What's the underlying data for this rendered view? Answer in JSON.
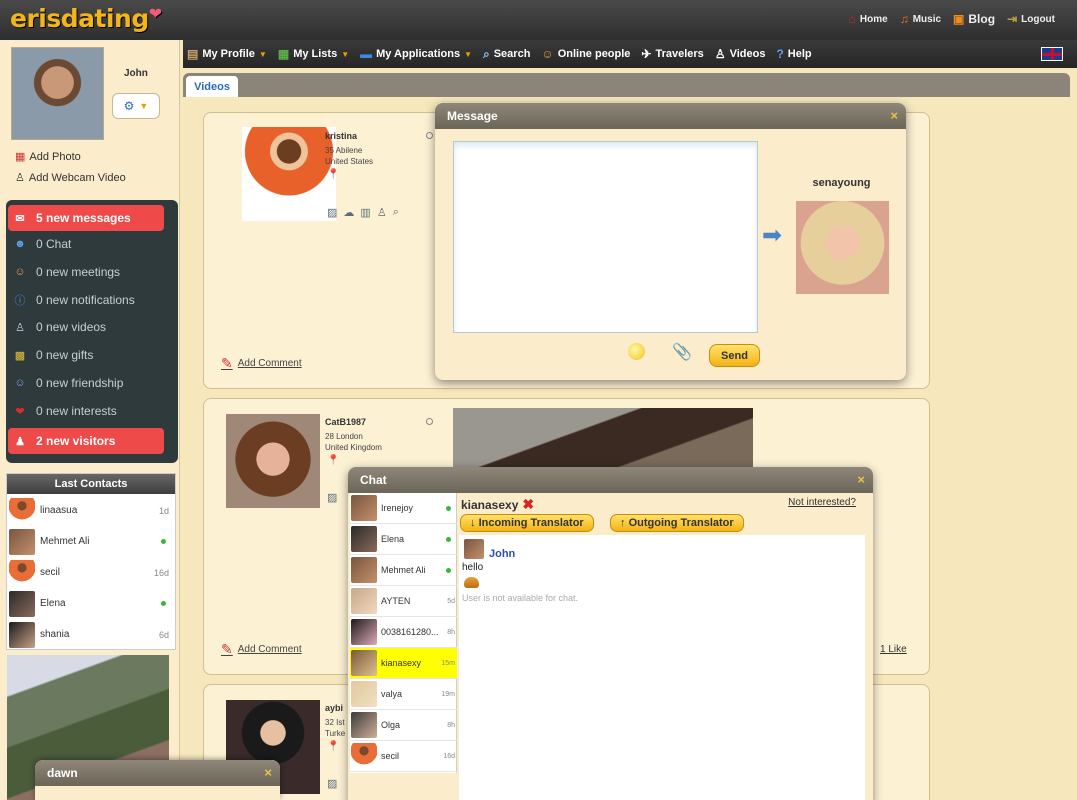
{
  "header": {
    "logo": "erisdating",
    "logo_heart": "❤",
    "links": [
      {
        "label": "Home",
        "icon": "house-icon"
      },
      {
        "label": "Music",
        "icon": "headphones-icon"
      },
      {
        "label": "Blog",
        "icon": "blog-icon"
      },
      {
        "label": "Logout",
        "icon": "logout-icon"
      }
    ]
  },
  "profile": {
    "name": "John",
    "add_photo": "Add Photo",
    "add_webcam_video": "Add Webcam Video"
  },
  "notifications": [
    {
      "label": "5 new messages",
      "active": true
    },
    {
      "label": "0 Chat",
      "active": false
    },
    {
      "label": "0 new meetings",
      "active": false
    },
    {
      "label": "0 new notifications",
      "active": false
    },
    {
      "label": "0 new videos",
      "active": false
    },
    {
      "label": "0 new gifts",
      "active": false
    },
    {
      "label": "0 new friendship",
      "active": false
    },
    {
      "label": "0 new interests",
      "active": false
    },
    {
      "label": "2 new visitors",
      "active": true
    }
  ],
  "last_contacts": {
    "title": "Last Contacts",
    "items": [
      {
        "name": "linaasua",
        "when": "1d",
        "online": false
      },
      {
        "name": "Mehmet Ali",
        "when": "",
        "online": true
      },
      {
        "name": "secil",
        "when": "16d",
        "online": false
      },
      {
        "name": "Elena",
        "when": "",
        "online": true
      },
      {
        "name": "shania",
        "when": "6d",
        "online": false
      }
    ]
  },
  "nav": {
    "items": [
      {
        "label": "My Profile",
        "icon": "profile-icon",
        "dropdown": true
      },
      {
        "label": "My Lists",
        "icon": "calendar-icon",
        "dropdown": true
      },
      {
        "label": "My Applications",
        "icon": "apps-icon",
        "dropdown": true
      },
      {
        "label": "Search",
        "icon": "search-icon",
        "dropdown": false
      },
      {
        "label": "Online people",
        "icon": "people-icon",
        "dropdown": false
      },
      {
        "label": "Travelers",
        "icon": "plane-icon",
        "dropdown": false
      },
      {
        "label": "Videos",
        "icon": "webcam-icon",
        "dropdown": false
      },
      {
        "label": "Help",
        "icon": "help-icon",
        "dropdown": false
      }
    ],
    "tab": "Videos"
  },
  "cards": [
    {
      "name": "kristina",
      "meta1": "35 Abilene",
      "meta2": "United States",
      "add_comment": "Add Comment"
    },
    {
      "name": "CatB1987",
      "meta1": "28 London",
      "meta2": "United Kingdom",
      "add_comment": "Add Comment",
      "likes": "1 Like"
    },
    {
      "name": "aybi",
      "meta1": "32 Ist",
      "meta2": "Turke"
    }
  ],
  "message_popup": {
    "title": "Message",
    "close": "×",
    "recipient": "senayoung",
    "send": "Send"
  },
  "chat_popup": {
    "title": "Chat",
    "close": "×",
    "contacts": [
      {
        "name": "Irenejoy",
        "when": "",
        "online": true
      },
      {
        "name": "Elena",
        "when": "",
        "online": true
      },
      {
        "name": "Mehmet Ali",
        "when": "",
        "online": true
      },
      {
        "name": "AYTEN",
        "when": "5d",
        "online": false
      },
      {
        "name": "0038161280...",
        "when": "8h",
        "online": false
      },
      {
        "name": "kianasexy",
        "when": "15m",
        "online": false,
        "selected": true
      },
      {
        "name": "valya",
        "when": "19m",
        "online": false
      },
      {
        "name": "Olga",
        "when": "8h",
        "online": false
      },
      {
        "name": "secil",
        "when": "16d",
        "online": false
      }
    ],
    "active_user": "kianasexy",
    "not_interested": "Not interested?",
    "incoming_translator": "Incoming Translator",
    "outgoing_translator": "Outgoing Translator",
    "message_sender": "John",
    "message_text": "hello",
    "status": "User is not available for chat."
  },
  "dawn_popup": {
    "title": "dawn",
    "close": "×"
  }
}
